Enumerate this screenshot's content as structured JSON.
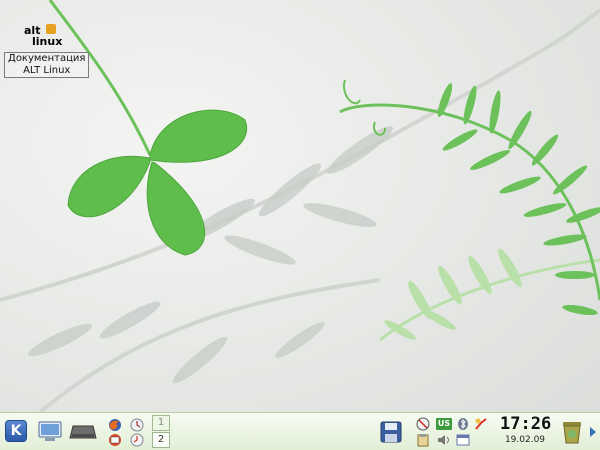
{
  "desktop": {
    "icons": [
      {
        "logo_text_1": "alt",
        "logo_text_2": "linux",
        "caption_line_1": "Документация",
        "caption_line_2": "ALT Linux"
      }
    ]
  },
  "panel": {
    "kmenu_glyph": "K",
    "pager": {
      "desktops": [
        "1",
        "2"
      ],
      "active_index": 0
    },
    "tray": {
      "keyboard_layout": "US"
    },
    "clock": {
      "time": "17:26",
      "date": "19.02.09"
    },
    "launchers": [
      "my-computer-icon",
      "hard-drive-icon",
      "firefox-icon",
      "clock-app-icon",
      "mail-icon",
      "time-settings-icon"
    ]
  }
}
